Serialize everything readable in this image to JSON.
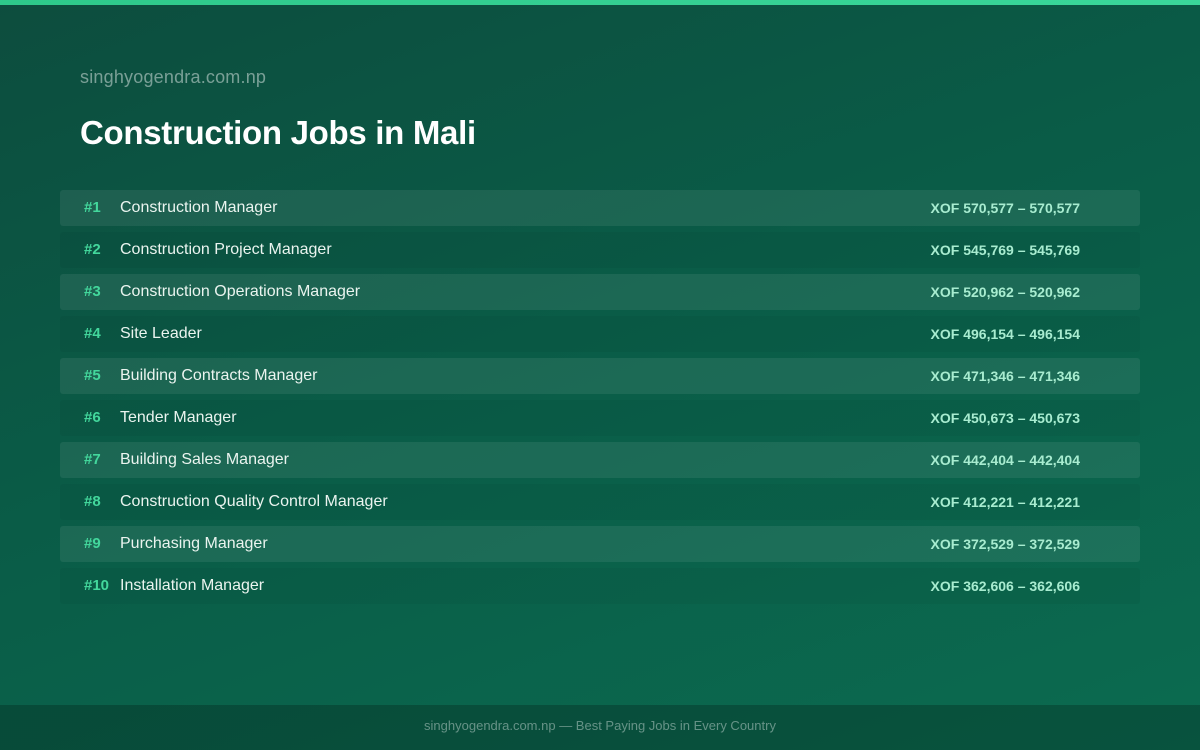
{
  "header": {
    "site_name": "singhyogendra.com.np",
    "title": "Construction Jobs in Mali"
  },
  "jobs": [
    {
      "rank": "#1",
      "title": "Construction Manager",
      "salary": "XOF 570,577 – 570,577"
    },
    {
      "rank": "#2",
      "title": "Construction Project Manager",
      "salary": "XOF 545,769 – 545,769"
    },
    {
      "rank": "#3",
      "title": "Construction Operations Manager",
      "salary": "XOF 520,962 – 520,962"
    },
    {
      "rank": "#4",
      "title": "Site Leader",
      "salary": "XOF 496,154 – 496,154"
    },
    {
      "rank": "#5",
      "title": "Building Contracts Manager",
      "salary": "XOF 471,346 – 471,346"
    },
    {
      "rank": "#6",
      "title": "Tender Manager",
      "salary": "XOF 450,673 – 450,673"
    },
    {
      "rank": "#7",
      "title": "Building Sales Manager",
      "salary": "XOF 442,404 – 442,404"
    },
    {
      "rank": "#8",
      "title": "Construction Quality Control Manager",
      "salary": "XOF 412,221 – 412,221"
    },
    {
      "rank": "#9",
      "title": "Purchasing Manager",
      "salary": "XOF 372,529 – 372,529"
    },
    {
      "rank": "#10",
      "title": "Installation Manager",
      "salary": "XOF 362,606 – 362,606"
    }
  ],
  "footer": {
    "text": "singhyogendra.com.np — Best Paying Jobs in Every Country"
  },
  "colors": {
    "accent": "#43d79c",
    "background": "#0a5c47",
    "salary": "#a8ecd0"
  }
}
